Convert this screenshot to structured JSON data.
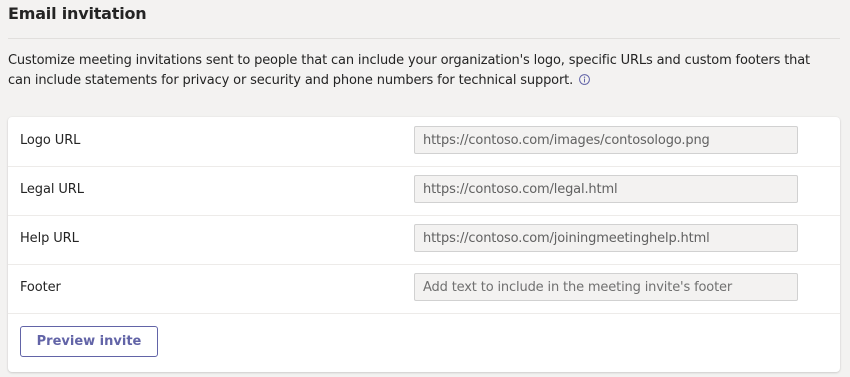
{
  "section": {
    "title": "Email invitation",
    "description": "Customize meeting invitations sent to people that can include your organization's logo, specific URLs and custom footers that can include statements for privacy or security and phone numbers for technical support."
  },
  "fields": [
    {
      "label": "Logo URL",
      "value": "https://contoso.com/images/contosologo.png",
      "placeholder": ""
    },
    {
      "label": "Legal URL",
      "value": "https://contoso.com/legal.html",
      "placeholder": ""
    },
    {
      "label": "Help URL",
      "value": "https://contoso.com/joiningmeetinghelp.html",
      "placeholder": ""
    },
    {
      "label": "Footer",
      "value": "",
      "placeholder": "Add text to include in the meeting invite's footer"
    }
  ],
  "actions": {
    "preview_label": "Preview invite"
  },
  "icons": {
    "info": "info-icon"
  },
  "colors": {
    "accent": "#6264a7",
    "background": "#f3f2f1",
    "card": "#ffffff"
  }
}
